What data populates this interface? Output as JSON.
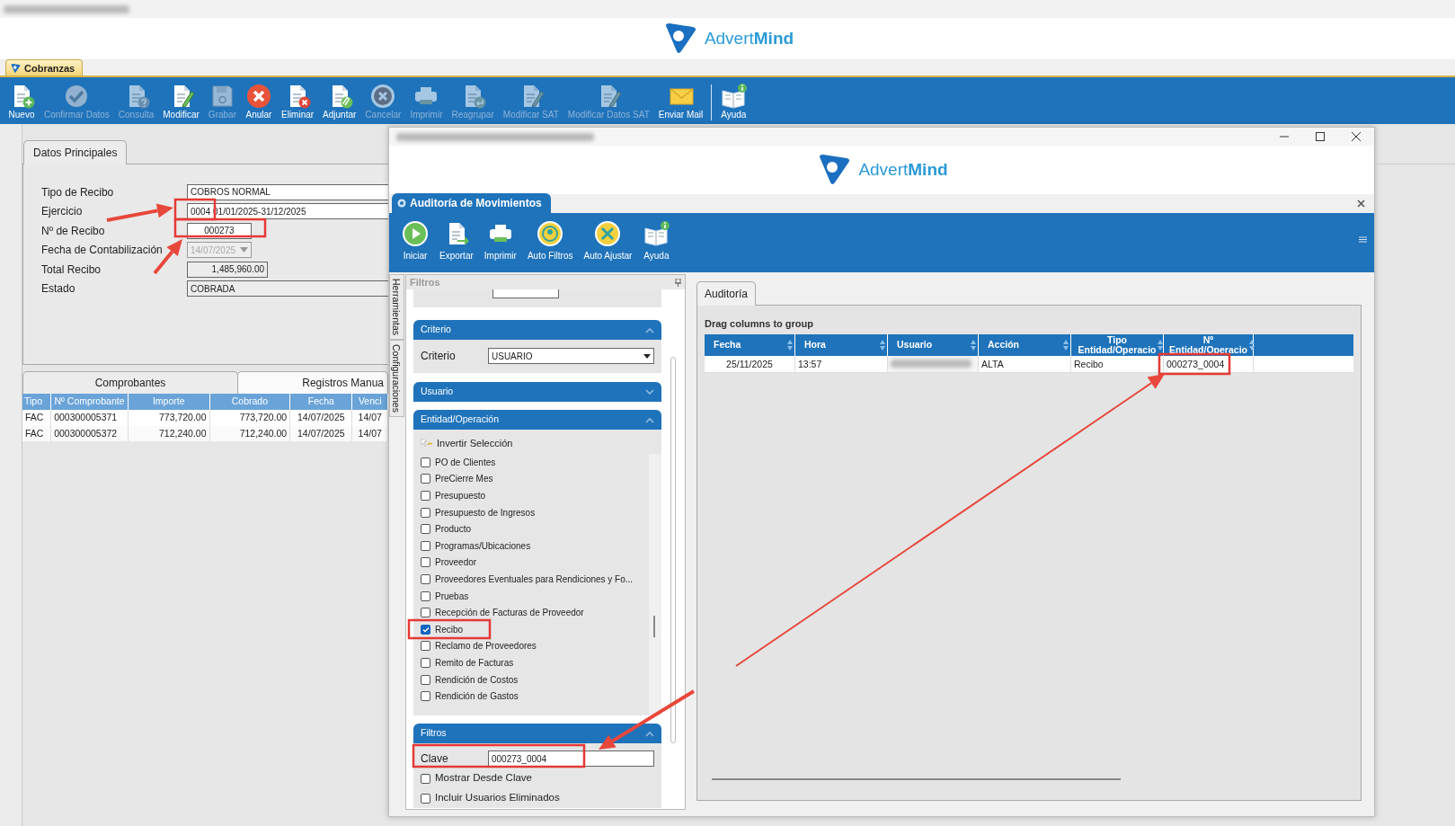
{
  "main_window": {
    "logo": {
      "text": "Advert**Mind**"
    },
    "module_tab": {
      "label": "Cobranzas",
      "selected": true
    },
    "toolbar": [
      {
        "label": "Nuevo",
        "kind": "doc-plus",
        "disabled": false,
        "separator_before": false
      },
      {
        "label": "Confirmar Datos",
        "kind": "check",
        "disabled": true,
        "separator_before": false
      },
      {
        "label": "Consulta",
        "kind": "doc-question",
        "disabled": true,
        "separator_before": false
      },
      {
        "label": "Modificar",
        "kind": "doc-pencil",
        "disabled": false,
        "separator_before": false
      },
      {
        "label": "Grabar",
        "kind": "disk",
        "disabled": true,
        "separator_before": false
      },
      {
        "label": "Anular",
        "kind": "cancel-red",
        "disabled": false,
        "separator_before": false
      },
      {
        "label": "Eliminar",
        "kind": "doc-x",
        "disabled": false,
        "separator_before": false
      },
      {
        "label": "Adjuntar",
        "kind": "doc-clip",
        "disabled": false,
        "separator_before": false
      },
      {
        "label": "Cancelar",
        "kind": "cancel-ring",
        "disabled": true,
        "separator_before": false
      },
      {
        "label": "Imprimir",
        "kind": "printer",
        "disabled": true,
        "separator_before": false
      },
      {
        "label": "Reagrupar",
        "kind": "doc-return",
        "disabled": true,
        "separator_before": false
      },
      {
        "label": "Modificar SAT",
        "kind": "doc-pencil",
        "disabled": true,
        "separator_before": false
      },
      {
        "label": "Modificar Datos SAT",
        "kind": "doc-pencil",
        "disabled": true,
        "separator_before": false
      },
      {
        "label": "Enviar Mail",
        "kind": "envelope",
        "disabled": false,
        "separator_before": false
      },
      {
        "label": "Ayuda",
        "kind": "book",
        "disabled": false,
        "separator_before": true
      }
    ],
    "form": {
      "tab": {
        "label": "Datos Principales",
        "selected": true
      },
      "fields": [
        {
          "label": "Tipo de Recibo",
          "value": "COBROS NORMAL",
          "kind": "select",
          "disabled": false
        },
        {
          "label": "Ejercicio",
          "value": "0004 01/01/2025-31/12/2025",
          "kind": "select",
          "disabled": false
        },
        {
          "label": "Nº de Recibo",
          "value": "000273",
          "kind": "text",
          "disabled": false
        },
        {
          "label": "Fecha de Contabilización",
          "value": "14/07/2025",
          "kind": "date",
          "disabled": true
        },
        {
          "label": "Total Recibo",
          "value": "1,485,960.00",
          "kind": "number",
          "disabled": false
        },
        {
          "label": "Estado",
          "value": "COBRADA",
          "kind": "readonly",
          "disabled": false
        }
      ]
    },
    "details": {
      "tabs": [
        {
          "label": "Comprobantes",
          "selected": true
        },
        {
          "label": "Registros Manua",
          "selected": false
        }
      ],
      "columns": [
        "Tipo",
        "Nº Comprobante",
        "Importe",
        "Cobrado",
        "Fecha",
        "Venci"
      ],
      "rows": [
        [
          "FAC",
          "000300005371",
          "773,720.00",
          "773,720.00",
          "14/07/2025",
          "14/07"
        ],
        [
          "FAC",
          "000300005372",
          "712,240.00",
          "712,240.00",
          "14/07/2025",
          "14/07"
        ]
      ]
    }
  },
  "audit_window": {
    "logo": {
      "text": "Advert**Mind**"
    },
    "tab": {
      "label": "Auditoría de Movimientos",
      "selected": true
    },
    "toolbar": [
      {
        "label": "Iniciar",
        "kind": "play"
      },
      {
        "label": "Exportar",
        "kind": "export"
      },
      {
        "label": "Imprimir",
        "kind": "printer"
      },
      {
        "label": "Auto Filtros",
        "kind": "autofilter"
      },
      {
        "label": "Auto Ajustar",
        "kind": "autofit"
      },
      {
        "label": "Ayuda",
        "kind": "book"
      }
    ],
    "side_tabs": [
      "Herramientas",
      "Configuraciones"
    ],
    "filters": {
      "title": "Filtros",
      "sections": [
        {
          "title": "Criterio",
          "expanded": true,
          "kind": "select",
          "label": "Criterio",
          "value": "USUARIO"
        },
        {
          "title": "Usuario",
          "expanded": false
        },
        {
          "title": "Entidad/Operación",
          "expanded": true,
          "kind": "checklist",
          "invert_label": "Invertir Selección",
          "items": [
            {
              "label": "PO de Clientes",
              "checked": false
            },
            {
              "label": "PreCierre Mes",
              "checked": false
            },
            {
              "label": "Presupuesto",
              "checked": false
            },
            {
              "label": "Presupuesto de Ingresos",
              "checked": false
            },
            {
              "label": "Producto",
              "checked": false
            },
            {
              "label": "Programas/Ubicaciones",
              "checked": false
            },
            {
              "label": "Proveedor",
              "checked": false
            },
            {
              "label": "Proveedores Eventuales para Rendiciones y Fo...",
              "checked": false
            },
            {
              "label": "Pruebas",
              "checked": false
            },
            {
              "label": "Recepción de Facturas de Proveedor",
              "checked": false
            },
            {
              "label": "Recibo",
              "checked": true
            },
            {
              "label": "Reclamo de Proveedores",
              "checked": false
            },
            {
              "label": "Remito de Facturas",
              "checked": false
            },
            {
              "label": "Rendición de Costos",
              "checked": false
            },
            {
              "label": "Rendición de Gastos",
              "checked": false
            }
          ]
        },
        {
          "title": "Filtros",
          "expanded": true,
          "kind": "key",
          "label": "Clave",
          "value": "000273_0004",
          "options": [
            {
              "label": "Mostrar Desde Clave",
              "checked": false
            },
            {
              "label": "Incluir Usuarios Eliminados",
              "checked": false
            }
          ]
        }
      ]
    },
    "results": {
      "tab": {
        "label": "Auditoría",
        "selected": true
      },
      "group_hint": "Drag columns to group",
      "columns": [
        "Fecha",
        "Hora",
        "Usuario",
        "Acción",
        "Tipo Entidad/Operacio",
        "Nº Entidad/Operacio"
      ],
      "rows": [
        {
          "cells": [
            {
              "kind": "text",
              "text": "25/11/2025"
            },
            {
              "kind": "text",
              "text": "13:57"
            },
            {
              "kind": "blurred"
            },
            {
              "kind": "text",
              "text": "ALTA"
            },
            {
              "kind": "text",
              "text": "Recibo"
            },
            {
              "kind": "text",
              "text": "000273_0004"
            }
          ]
        }
      ]
    }
  }
}
